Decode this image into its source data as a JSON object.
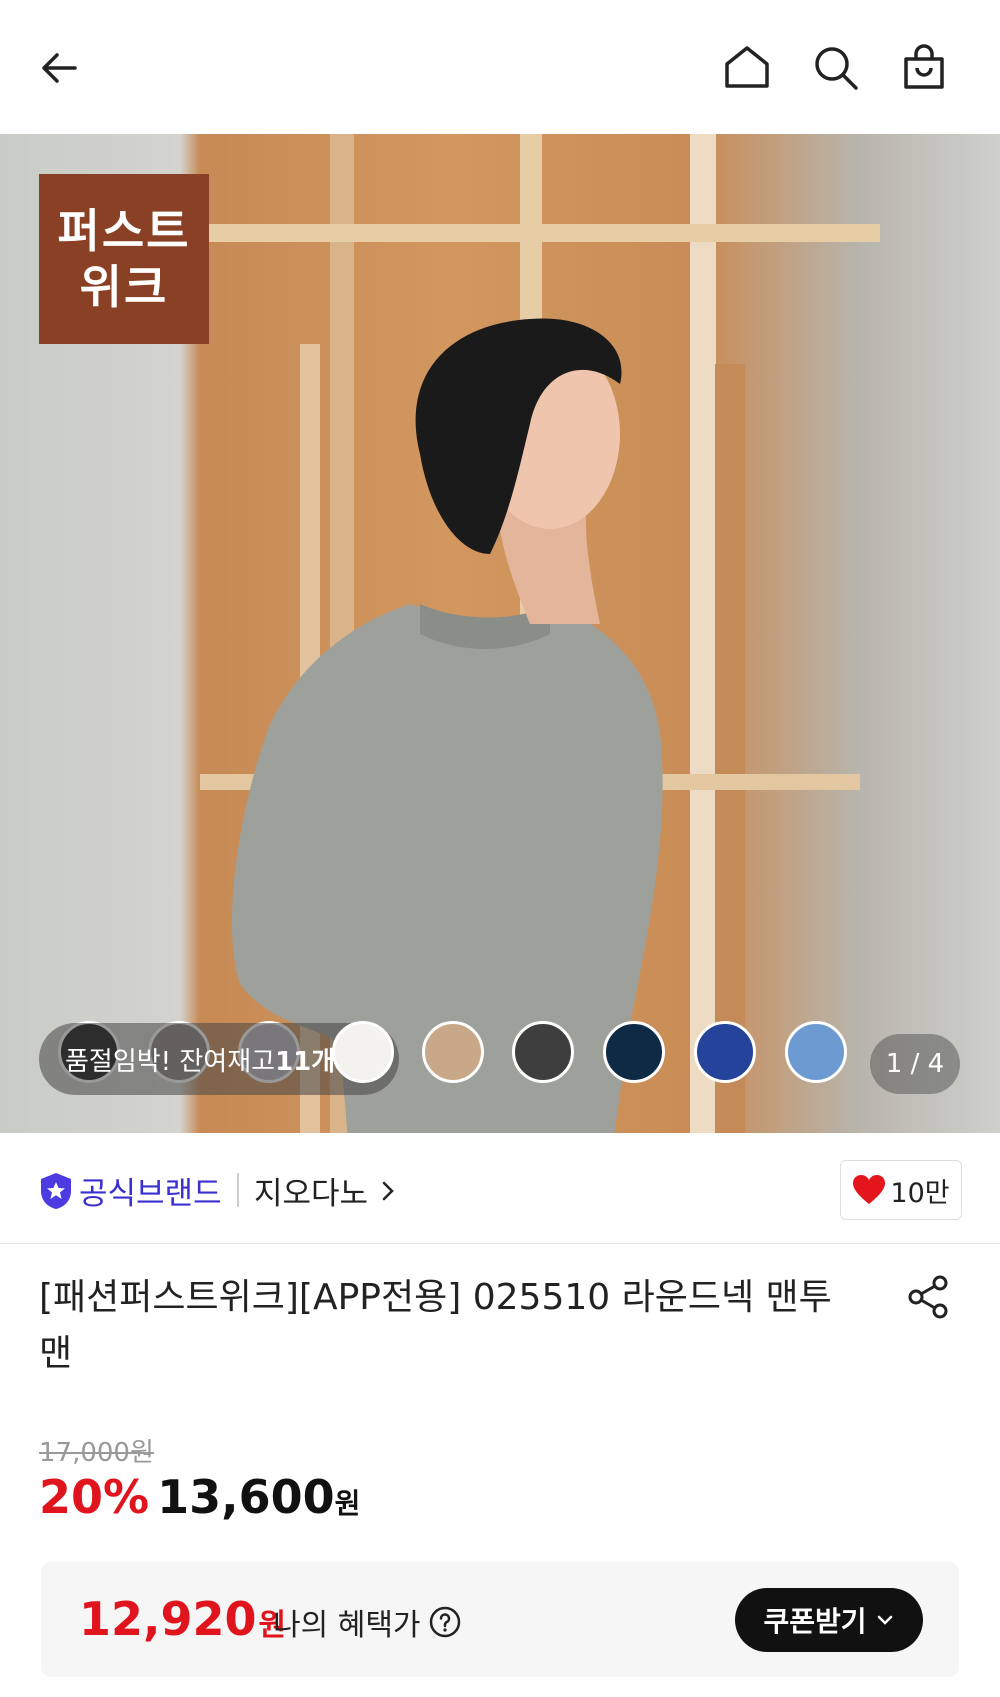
{
  "header": {
    "back_icon": "arrow-left-icon",
    "home_icon": "home-icon",
    "search_icon": "search-icon",
    "cart_icon": "shopping-bag-icon"
  },
  "hero": {
    "badge_line1": "퍼스트",
    "badge_line2": "위크",
    "stock_prefix": "품절임박! 잔여재고 ",
    "stock_count": "11개!",
    "pager": "1 / 4",
    "swatches": [
      "#111111",
      "#8a8282",
      "#b8b4bd",
      "#f4f2ef",
      "#c9a88a",
      "#3e3e3e",
      "#0f2a44",
      "#24439a",
      "#6d9ad0"
    ]
  },
  "brand": {
    "official_label": "공식브랜드",
    "name": "지오다노",
    "like_count": "10만"
  },
  "product": {
    "title": "[패션퍼스트위크][APP전용] 025510 라운드넥 맨투맨",
    "original_price": "17,000원",
    "discount": "20%",
    "price": "13,600",
    "currency": "원"
  },
  "benefit": {
    "price": "12,920",
    "currency": "원",
    "label": "나의 혜택가",
    "coupon_button": "쿠폰받기"
  },
  "colors": {
    "accent_red": "#e0141d",
    "brand_purple": "#3a2fcf",
    "badge_brown": "#8a4024"
  }
}
